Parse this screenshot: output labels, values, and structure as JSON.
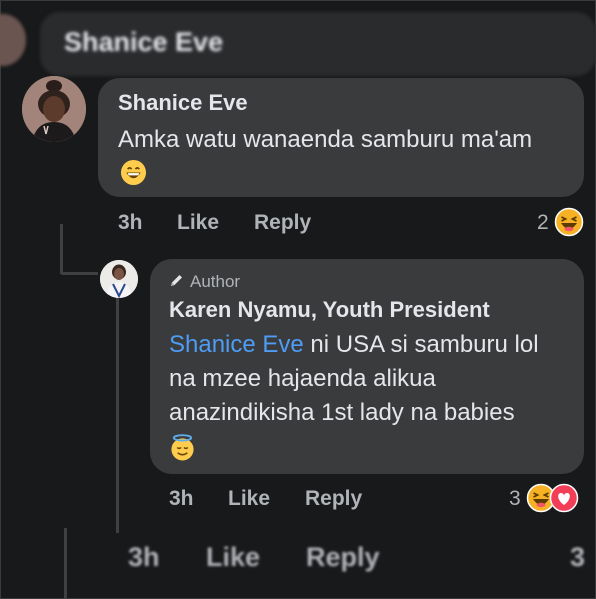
{
  "ghost_top": {
    "name": "Shanice Eve"
  },
  "comment": {
    "author": "Shanice Eve",
    "text": "Amka watu wanaenda samburu ma'am",
    "emoji": "grinning-face-emoji",
    "time": "3h",
    "like_label": "Like",
    "reply_label": "Reply",
    "reaction_count": "2",
    "reaction_icon": "haha-reaction-icon"
  },
  "reply": {
    "badge": "Author",
    "author": "Karen Nyamu, Youth President",
    "mention": "Shanice Eve",
    "text": " ni USA si samburu lol na mzee hajaenda alikua anazindikisha 1st lady na babies",
    "emoji": "smiling-face-with-halo-emoji",
    "time": "3h",
    "like_label": "Like",
    "reply_label": "Reply",
    "reaction_count": "3",
    "reaction_icons": [
      "haha-reaction-icon",
      "love-reaction-icon"
    ]
  },
  "ghost_bottom": {
    "time": "3h",
    "like_label": "Like",
    "reply_label": "Reply",
    "reaction_count": "3"
  },
  "colors": {
    "background": "#18191a",
    "bubble": "#3a3b3c",
    "text_primary": "#e4e6eb",
    "text_secondary": "#b0b3b8",
    "mention": "#4e9cf5",
    "love": "#f33e58",
    "haha": "#f7b125"
  }
}
